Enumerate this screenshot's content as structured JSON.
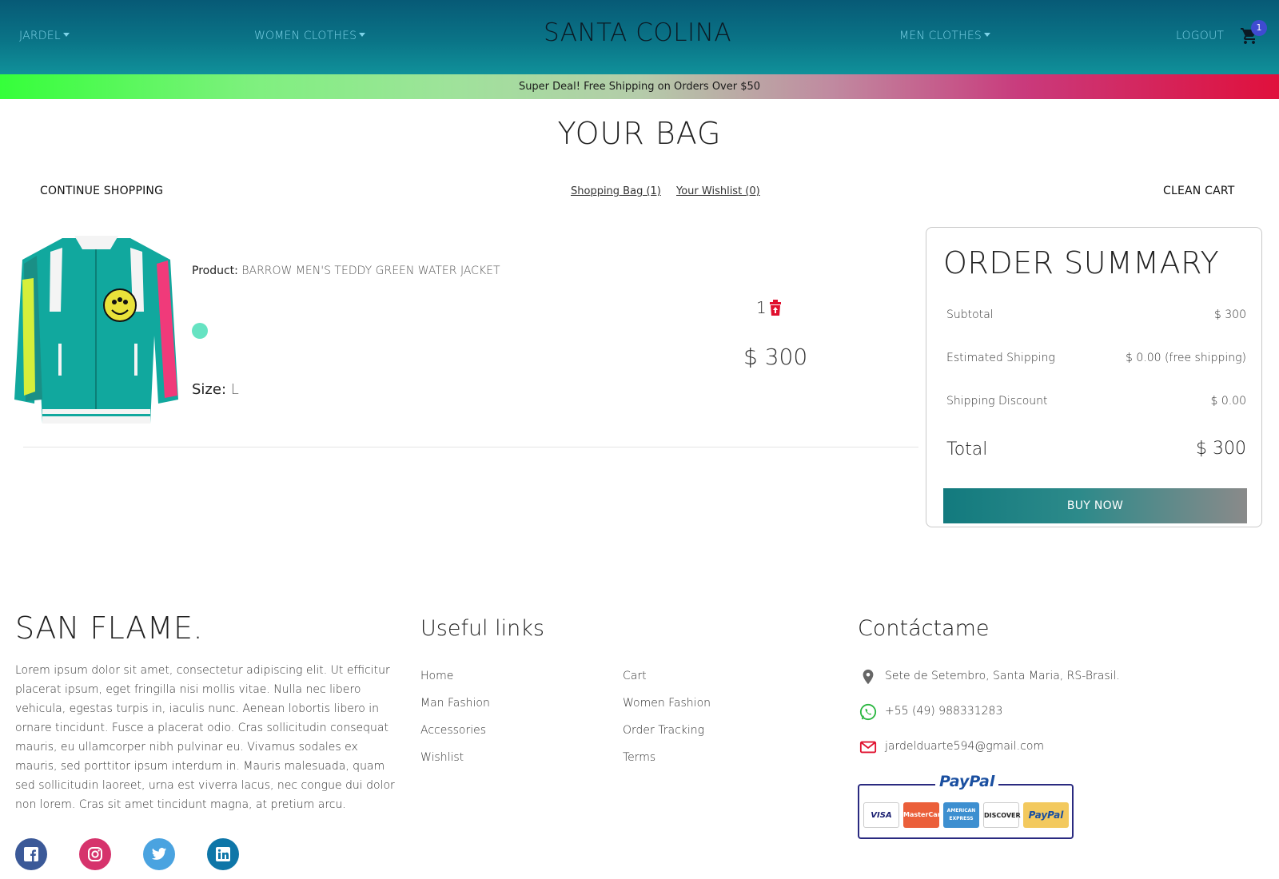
{
  "nav": {
    "left_menu": "JARDEL",
    "women_menu": "WOMEN CLOTHES",
    "brand": "SANTA COLINA",
    "men_menu": "MEN CLOTHES",
    "logout": "LOGOUT",
    "cart_count": "1"
  },
  "promo": {
    "text": "Super Deal! Free Shipping on Orders Over $50"
  },
  "page": {
    "title": "YOUR BAG"
  },
  "actions": {
    "continue_shopping": "CONTINUE SHOPPING",
    "shopping_bag": "Shopping Bag (1)",
    "wishlist": "Your Wishlist (0)",
    "clean_cart": "CLEAN CART"
  },
  "product": {
    "product_label": "Product:",
    "name": "BARROW MEN'S TEDDY GREEN WATER JACKET",
    "color": "#66e3c2",
    "size_label": "Size:",
    "size": "L",
    "quantity": "1",
    "price": "$ 300"
  },
  "summary": {
    "title": "ORDER SUMMARY",
    "subtotal_label": "Subtotal",
    "subtotal": "$ 300",
    "shipping_label": "Estimated Shipping",
    "shipping": "$ 0.00 (free shipping)",
    "discount_label": "Shipping Discount",
    "discount": "$ 0.00",
    "total_label": "Total",
    "total": "$ 300",
    "buy_button": "BUY NOW"
  },
  "footer": {
    "brand": "SAN FLAME.",
    "description": "Lorem ipsum dolor sit amet, consectetur adipiscing elit. Ut efficitur placerat ipsum, eget fringilla nisi mollis vitae. Nulla nec libero vehicula, egestas turpis in, iaculis nunc. Aenean lobortis libero in ornare tincidunt. Fusce a placerat odio. Cras sollicitudin consequat mauris, eu ullamcorper nibh pulvinar eu. Vivamus sodales ex mauris, sed porttitor ipsum interdum in. Mauris malesuada, quam sed sollicitudin laoreet, urna est viverra lacus, nec congue dui dolor non lorem. Cras sit amet tincidunt magna, at pretium arcu.",
    "social_icons": [
      "facebook-icon",
      "instagram-icon",
      "twitter-icon",
      "linkedin-icon"
    ],
    "links_title": "Useful links",
    "links_col1": [
      "Home",
      "Man Fashion",
      "Accessories",
      "Wishlist"
    ],
    "links_col2": [
      "Cart",
      "Women Fashion",
      "Order Tracking",
      "Terms"
    ],
    "contact_title": "Contáctame",
    "address": "Sete de Setembro, Santa Maria, RS-Brasil.",
    "phone": "+55 (49) 988331283",
    "email": "jardelduarte594@gmail.com",
    "payment_label": "PayPal",
    "cards": [
      "VISA",
      "MasterCard",
      "AMERICAN EXPRESS",
      "DISCOVER",
      "PayPal"
    ]
  },
  "colors": {
    "nav_top": "#075a76",
    "nav_bottom": "#10919a",
    "delete_red": "#e0102e",
    "facebook": "#3b5998",
    "instagram": "#d6336c",
    "twitter": "#4aa3e0",
    "linkedin": "#0e76a8"
  }
}
